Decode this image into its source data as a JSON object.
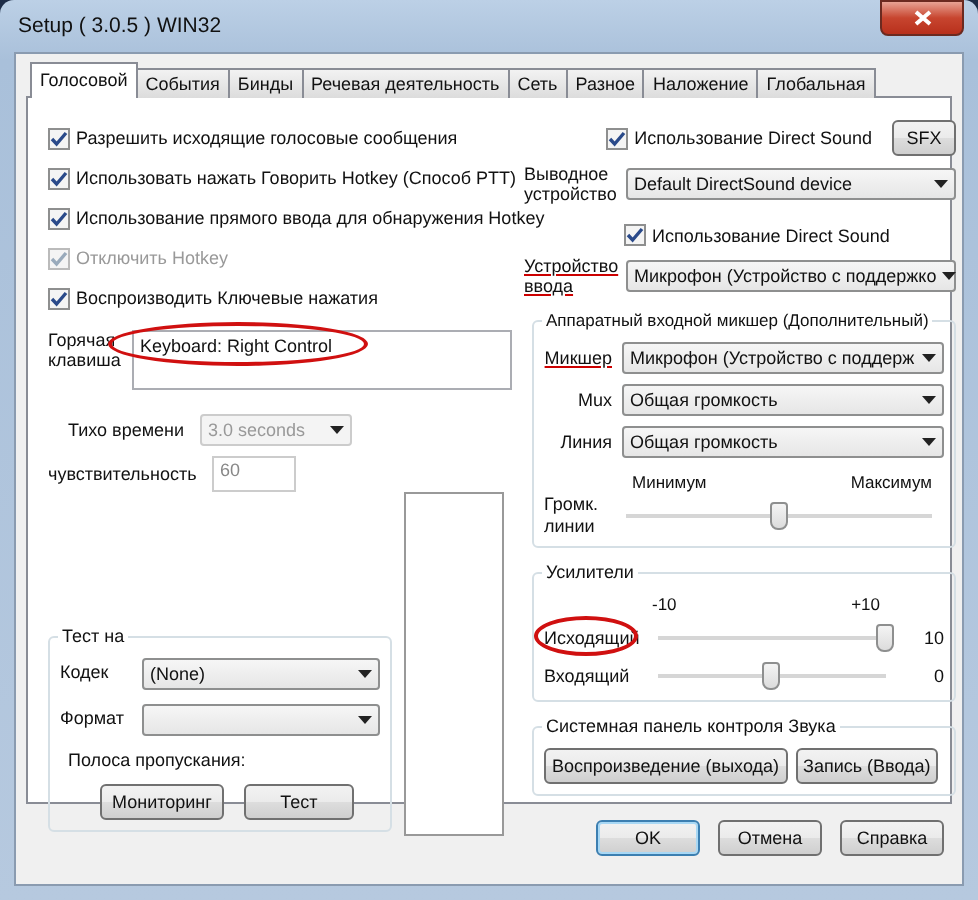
{
  "window": {
    "title": "Setup ( 3.0.5 ) WIN32"
  },
  "tabs": [
    {
      "label": "Голосовой",
      "selected": true
    },
    {
      "label": "События",
      "selected": false
    },
    {
      "label": "Бинды",
      "selected": false
    },
    {
      "label": "Речевая деятельность",
      "selected": false
    },
    {
      "label": "Сеть",
      "selected": false
    },
    {
      "label": "Разное",
      "selected": false
    },
    {
      "label": "Наложение",
      "selected": false
    },
    {
      "label": "Глобальная",
      "selected": false
    }
  ],
  "options": [
    {
      "label": "Разрешить исходящие голосовые сообщения",
      "checked": true,
      "disabled": false
    },
    {
      "label": "Использовать нажать Говорить Hotkey (Способ PTT)",
      "checked": true,
      "disabled": false
    },
    {
      "label": "Использование прямого ввода для обнаружения Hotkey",
      "checked": true,
      "disabled": false
    },
    {
      "label": "Отключить Hotkey",
      "checked": true,
      "disabled": true
    },
    {
      "label": "Воспроизводить Ключевые нажатия",
      "checked": true,
      "disabled": false
    }
  ],
  "hotkey": {
    "label": "Горячая клавиша",
    "value": "Keyboard: Right Control",
    "circled": true
  },
  "silence": {
    "label": "Тихо времени",
    "value": "3.0 seconds",
    "disabled": true
  },
  "sensitivity": {
    "label": "чувствительность",
    "value": "60",
    "disabled": true
  },
  "test": {
    "title": "Тест на",
    "codec": {
      "label": "Кодек",
      "value": "(None)"
    },
    "format": {
      "label": "Формат"
    },
    "bandwidth_label": "Полоса пропускания:",
    "buttons": [
      "Мониторинг",
      "Тест"
    ]
  },
  "output": {
    "direct_sound": {
      "label": "Использование Direct Sound",
      "checked": true
    },
    "sfx_button": "SFX",
    "device": {
      "label": "Выводное устройство",
      "value": "Default DirectSound device",
      "underlined": false
    }
  },
  "input": {
    "direct_sound": {
      "label": "Использование Direct Sound",
      "checked": true
    },
    "device": {
      "label": "Устройство ввода",
      "value": "Микрофон (Устройство с поддержко",
      "underlined": true
    }
  },
  "mixer": {
    "title": "Аппаратный входной микшер (Дополнительный)",
    "fields": [
      {
        "label": "Микшер",
        "value": "Микрофон (Устройство с поддерж",
        "underlined": true
      },
      {
        "label": "Mux",
        "value": "Общая громкость",
        "underlined": false
      },
      {
        "label": "Линия",
        "value": "Общая громкость",
        "underlined": false
      }
    ],
    "volume": {
      "label": "Громк. линии",
      "min_label": "Минимум",
      "max_label": "Максимум",
      "level": 0.5
    }
  },
  "amplifiers": {
    "title": "Усилители",
    "min_label": "-10",
    "max_label": "+10",
    "rows": [
      {
        "label": "Исходящий",
        "level": 1.0,
        "reading": "10",
        "circled": true
      },
      {
        "label": "Входящий",
        "level": 0.5,
        "reading": "0",
        "circled": false
      }
    ]
  },
  "sound_panel": {
    "title": "Системная панель контроля Звука",
    "buttons": [
      "Воспроизведение (выхода)",
      "Запись (Ввода)"
    ]
  },
  "footer_buttons": [
    {
      "label": "OK",
      "default": true
    },
    {
      "label": "Отмена",
      "default": false
    },
    {
      "label": "Справка",
      "default": false
    }
  ]
}
